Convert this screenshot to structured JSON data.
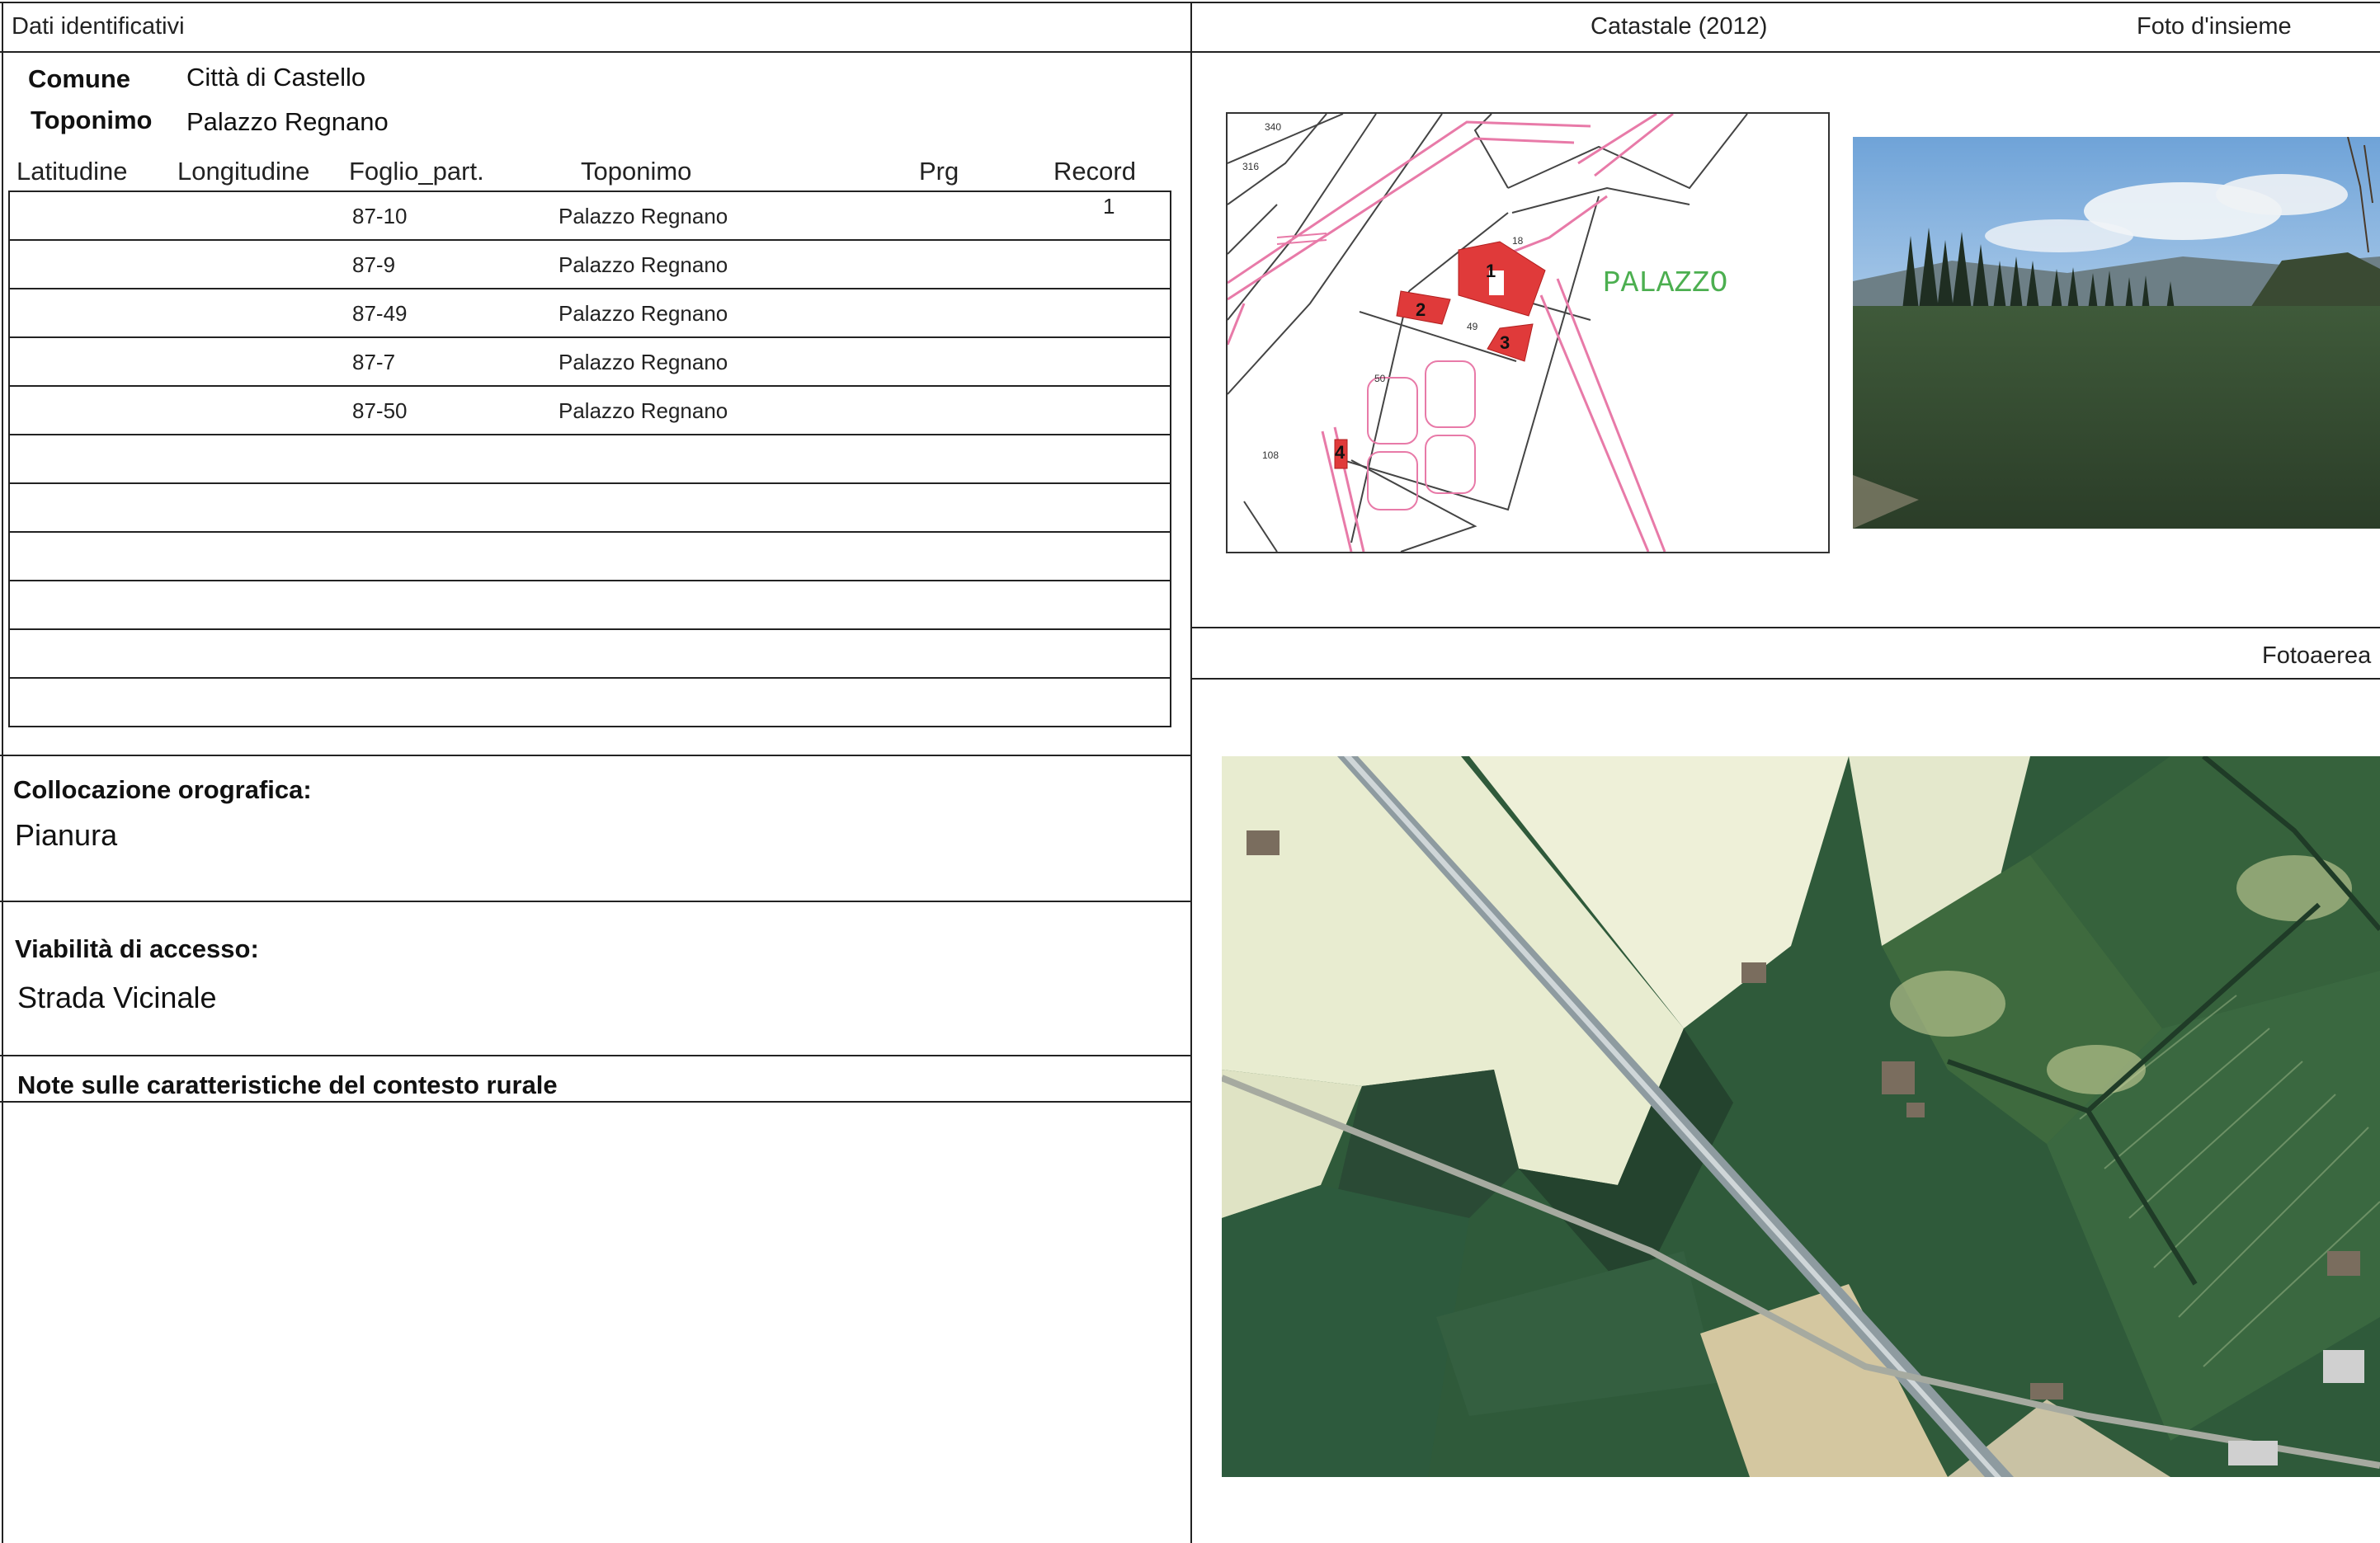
{
  "header": {
    "dati_title": "Dati identificativi",
    "catastale_title": "Catastale (2012)",
    "foto_title": "Foto d'insieme",
    "fotoaerea_title": "Fotoaerea"
  },
  "ident": {
    "comune_label": "Comune",
    "comune_value": "Città di Castello",
    "toponimo_label": "Toponimo",
    "toponimo_value": "Palazzo Regnano"
  },
  "table": {
    "columns": [
      "Latitudine",
      "Longitudine",
      "Foglio_part.",
      "Toponimo",
      "Prg",
      "Record"
    ],
    "rows": [
      {
        "foglio": "87-10",
        "toponimo": "Palazzo Regnano",
        "record": "1"
      },
      {
        "foglio": "87-9",
        "toponimo": "Palazzo Regnano",
        "record": ""
      },
      {
        "foglio": "87-49",
        "toponimo": "Palazzo Regnano",
        "record": ""
      },
      {
        "foglio": "87-7",
        "toponimo": "Palazzo Regnano",
        "record": ""
      },
      {
        "foglio": "87-50",
        "toponimo": "Palazzo Regnano",
        "record": ""
      },
      {
        "foglio": "",
        "toponimo": "",
        "record": ""
      },
      {
        "foglio": "",
        "toponimo": "",
        "record": ""
      },
      {
        "foglio": "",
        "toponimo": "",
        "record": ""
      },
      {
        "foglio": "",
        "toponimo": "",
        "record": ""
      },
      {
        "foglio": "",
        "toponimo": "",
        "record": ""
      },
      {
        "foglio": "",
        "toponimo": "",
        "record": ""
      }
    ]
  },
  "sections": {
    "orografica_label": "Collocazione orografica:",
    "orografica_value": "Pianura",
    "viabilita_label": "Viabilità di accesso:",
    "viabilita_value": "Strada Vicinale",
    "note_label": "Note sulle caratteristiche del contesto rurale"
  },
  "map": {
    "label": "PALAZZO",
    "parcel_numbers": [
      "1",
      "2",
      "3",
      "4"
    ],
    "small_numbers": [
      "340",
      "316",
      "18",
      "50",
      "49",
      "108"
    ]
  },
  "colors": {
    "map_red": "#e03a3a",
    "map_pink": "#e87aa8",
    "map_green_label": "#4caf50",
    "field_green": "#2f5a3a",
    "field_pale": "#e8ecd0"
  }
}
